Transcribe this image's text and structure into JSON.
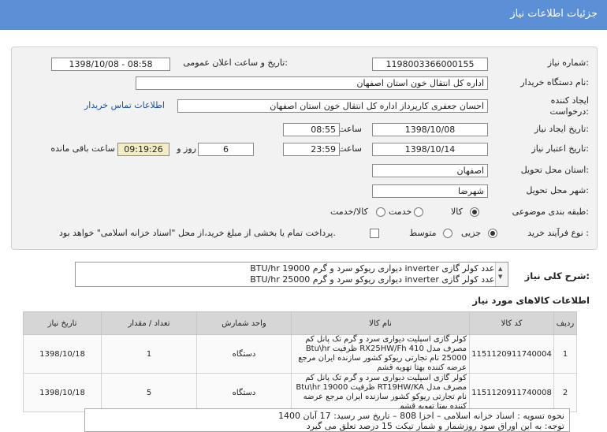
{
  "header": {
    "title": "جزئیات اطلاعات نیاز"
  },
  "form": {
    "need_number_label": "شماره نیاز:",
    "need_number": "1198003366000155",
    "announce_label": "تاریخ و ساعت اعلان عمومی:",
    "announce_value": "1398/10/08 - 08:58",
    "buyer_label": "نام دستگاه خریدار:",
    "buyer_value": "اداره کل انتقال خون استان اصفهان",
    "creator_label_1": "ایجاد کننده",
    "creator_label_2": "درخواست:",
    "creator_value": "احسان جعفری کارپرداز اداره کل انتقال خون استان اصفهان",
    "contact_link": "اطلاعات تماس خریدار",
    "create_date_label": "تاریخ ایجاد نیاز:",
    "create_date": "1398/10/08",
    "create_time_label": "ساعت",
    "create_time": "08:55",
    "valid_date_label": "تاریخ اعتبار نیاز:",
    "valid_date": "1398/10/14",
    "valid_time_label": "ساعت",
    "valid_time": "23:59",
    "days": "6",
    "days_label": "روز و",
    "remaining": "09:19:26",
    "remaining_label": "ساعت باقی مانده",
    "province_label": "استان محل تحویل:",
    "province": "اصفهان",
    "city_label": "شهر محل تحویل:",
    "city": "شهرضا",
    "category_label": "طبقه بندی موضوعی:",
    "category_options": [
      "کالا",
      "خدمت",
      "کالا/خدمت"
    ],
    "process_label": "نوع فرآیند خرید :",
    "process_options": [
      "جزیی",
      "متوسط"
    ],
    "payment_note": "پرداخت تمام یا بخشی از مبلغ خرید،از محل \"اسناد خزانه اسلامی\" خواهد بود."
  },
  "description": {
    "label": "شرح کلی نیاز:",
    "lines": [
      "5 عدد کولر گازی inverter دیواری ریوکو سرد و گرم BTU/hr 19000",
      "1 عدد کولر گازی inverter دیواری ریوکو سرد و گرم BTU/hr 25000"
    ]
  },
  "items_title": "اطلاعات کالاهای مورد نیاز",
  "table": {
    "headers": [
      "ردیف",
      "کد کالا",
      "نام کالا",
      "واحد شمارش",
      "تعداد / مقدار",
      "تاریخ نیاز"
    ],
    "rows": [
      {
        "n": "1",
        "code": "1151120911740004",
        "name": "کولر گازی اسپلیت دیواری سرد و گرم تک پانل کم مصرف مدل RX25HW/Fh 410 ظرفیت Btu\\hr 25000 نام تجارتی ریوکو کشور سازنده ایران مرجع عرضه کننده بهتا تهویه قشم",
        "unit": "دستگاه",
        "qty": "1",
        "date": "1398/10/18"
      },
      {
        "n": "2",
        "code": "1151120911740008",
        "name": "کولر گازی اسپلیت دیواری سرد و گرم تک پانل کم مصرف مدل RT19HW/KA ظرفیت Btu\\hr 19000 نام تجارتی ریوکو کشور سازنده ایران مرجع عرضه کننده بهتا تهویه قشم",
        "unit": "دستگاه",
        "qty": "5",
        "date": "1398/10/18"
      }
    ]
  },
  "notes": {
    "line1": "نحوه تسویه : اسناد خزانه اسلامی – اخزا 808 –  تاریخ سر رسید:  17 آبان 1400",
    "line2": "توجه: به این اوراق سود روزشمار و شمار تیکت 15 درصد تعلق می گیرد"
  }
}
